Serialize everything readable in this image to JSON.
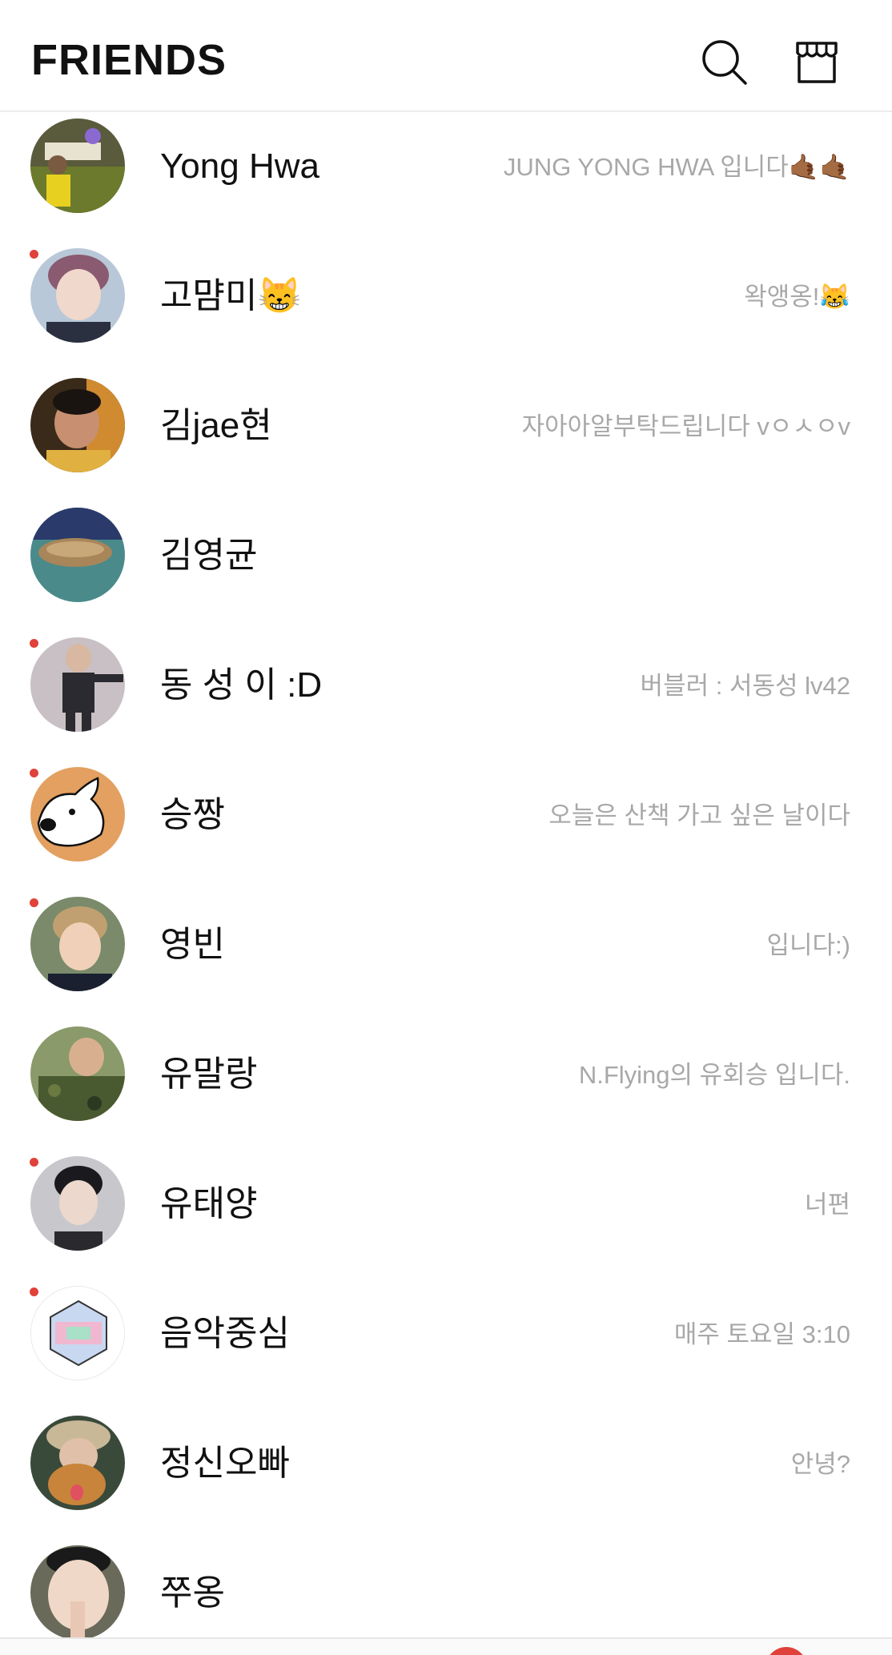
{
  "header": {
    "title": "FRIENDS",
    "search_icon": "search-icon",
    "shop_icon": "shop-icon"
  },
  "colors": {
    "accent_red": "#e0413a",
    "status_gray": "#a8a8a8",
    "name_black": "#111111"
  },
  "friends": [
    {
      "name": "Yong Hwa",
      "status": "JUNG YONG HWA 입니다🤙🏾🤙🏾",
      "new": false
    },
    {
      "name": "고먐미😸",
      "status": "왁앵옹!😹",
      "new": true
    },
    {
      "name": "김jae현",
      "status": "자아아알부탁드립니다 vㅇㅅㅇv",
      "new": false
    },
    {
      "name": "김영균",
      "status": "",
      "new": false
    },
    {
      "name": "동 성 이 :D",
      "status": "버블러 : 서동성  lv42",
      "new": true
    },
    {
      "name": "승짱",
      "status": "오늘은 산책 가고 싶은 날이다",
      "new": true
    },
    {
      "name": "영빈",
      "status": "입니다:)",
      "new": true
    },
    {
      "name": "유말랑",
      "status": "N.Flying의 유회승 입니다.",
      "new": false
    },
    {
      "name": "유태양",
      "status": "너편",
      "new": true
    },
    {
      "name": "음악중심",
      "status": "매주 토요일 3:10",
      "new": true
    },
    {
      "name": "정신오빠",
      "status": "안녕?",
      "new": false
    },
    {
      "name": "쭈옹",
      "status": "",
      "new": false
    }
  ]
}
